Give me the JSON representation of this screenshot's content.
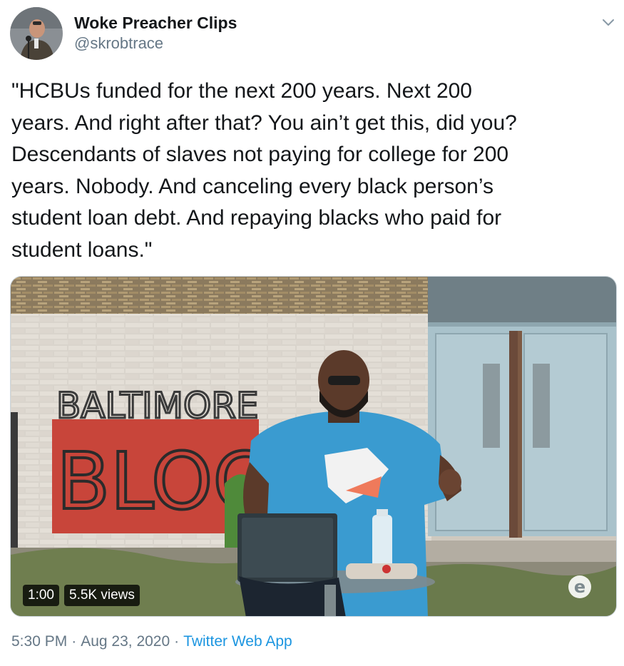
{
  "author": {
    "display_name": "Woke Preacher Clips",
    "handle": "@skrobtrace",
    "avatar_icon": "avatar-photo"
  },
  "tweet": {
    "lines": [
      "\"HCBUs funded for the next 200 years. Next 200",
      "years. And right after that? You ain’t get this, did you?",
      "Descendants of slaves not paying for college for 200",
      "years. Nobody. And canceling every black person’s",
      "student loan debt. And repaying blacks who paid for",
      "student loans.\""
    ]
  },
  "media": {
    "type": "video",
    "duration": "1:00",
    "views": "5.5K views",
    "graffiti_line1": "BALTIMORE",
    "graffiti_line2": "BLOCK",
    "watermark_letter": "e"
  },
  "meta": {
    "time": "5:30 PM",
    "separator": "·",
    "date": "Aug 23, 2020",
    "source": "Twitter Web App"
  },
  "colors": {
    "text": "#14171a",
    "secondary": "#657786",
    "link": "#1b95e0"
  }
}
